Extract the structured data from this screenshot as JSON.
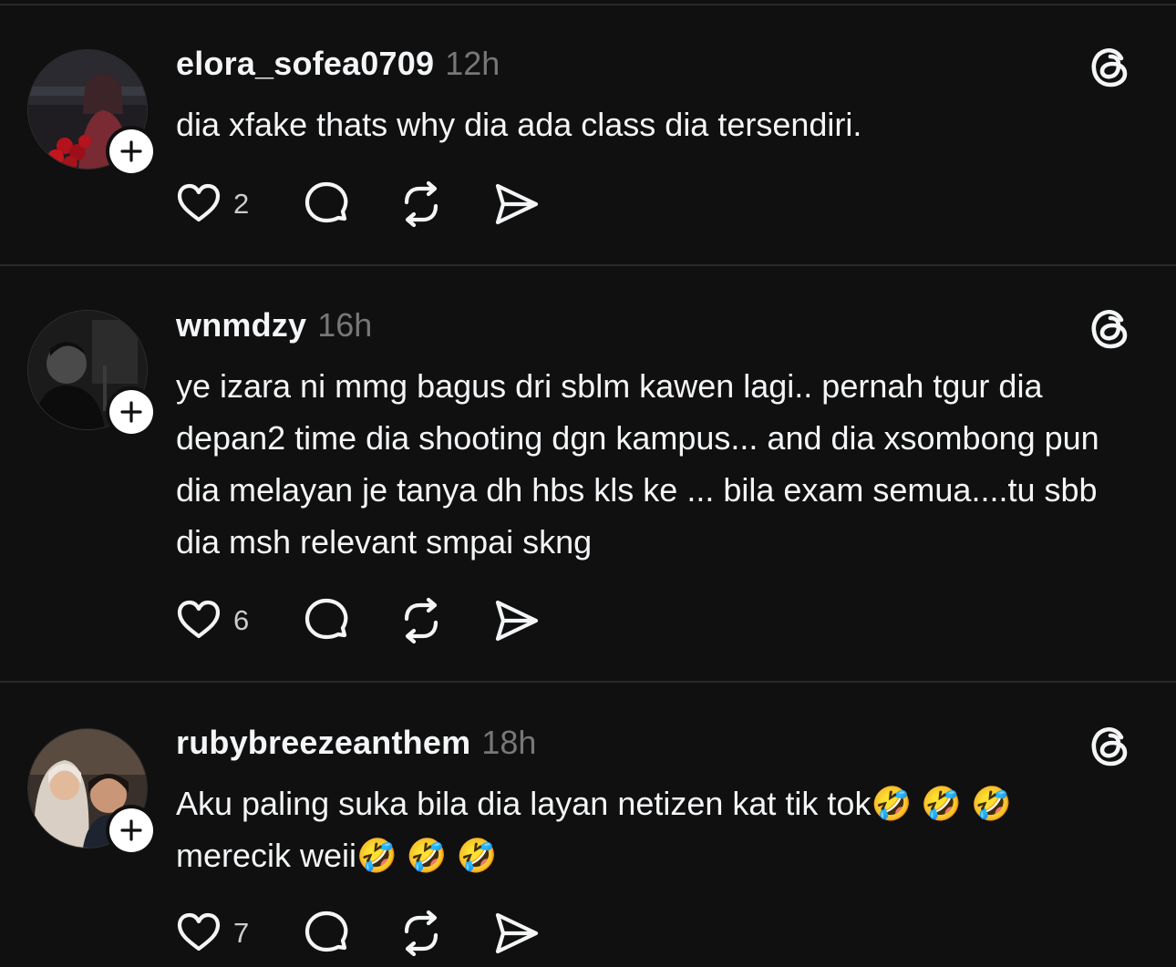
{
  "posts": [
    {
      "username": "elora_sofea0709",
      "time": "12h",
      "text": "dia xfake thats why dia ada class dia tersendiri.",
      "likes": "2"
    },
    {
      "username": "wnmdzy",
      "time": "16h",
      "text": "ye izara ni mmg bagus dri sblm kawen lagi.. pernah tgur dia depan2 time dia shooting dgn kampus... and dia xsombong pun dia melayan je tanya dh hbs kls ke ... bila exam semua....tu sbb dia msh relevant smpai skng",
      "likes": "6"
    },
    {
      "username": "rubybreezeanthem",
      "time": "18h",
      "text": "Aku paling suka bila dia layan netizen kat tik tok🤣 🤣 🤣 merecik weii🤣 🤣 🤣",
      "likes": "7"
    }
  ],
  "icons": {
    "like": "heart-icon",
    "reply": "comment-icon",
    "repost": "repost-icon",
    "share": "share-icon",
    "follow": "plus-icon",
    "app": "threads-logo-icon"
  },
  "colors": {
    "background": "#101010",
    "text": "#f3f5f7",
    "muted": "#777777",
    "divider": "#2a2a2a"
  }
}
